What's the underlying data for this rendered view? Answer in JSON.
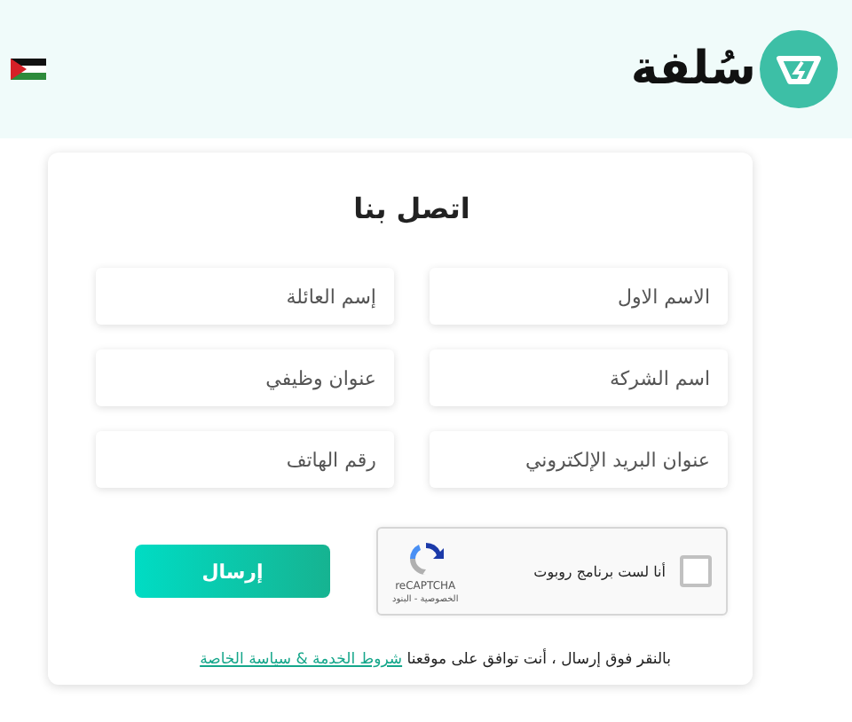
{
  "header": {
    "logo_text": "سُلفة"
  },
  "form": {
    "title": "اتصل بنا",
    "fields": [
      {
        "placeholder": "الاسم الاول"
      },
      {
        "placeholder": "إسم العائلة"
      },
      {
        "placeholder": "اسم الشركة"
      },
      {
        "placeholder": "عنوان وظيفي"
      },
      {
        "placeholder": "عنوان البريد الإلكتروني"
      },
      {
        "placeholder": "رقم الهاتف"
      }
    ],
    "captcha": {
      "label": "أنا لست برنامج روبوت",
      "checked": false,
      "brand": "reCAPTCHA",
      "links": "الخصوصية - البنود"
    },
    "submit": "إرسال",
    "terms": {
      "text": "بالنقر فوق إرسال ، أنت توافق على موقعنا",
      "link": "شروط الخدمة & سياسة الخاصة"
    }
  }
}
